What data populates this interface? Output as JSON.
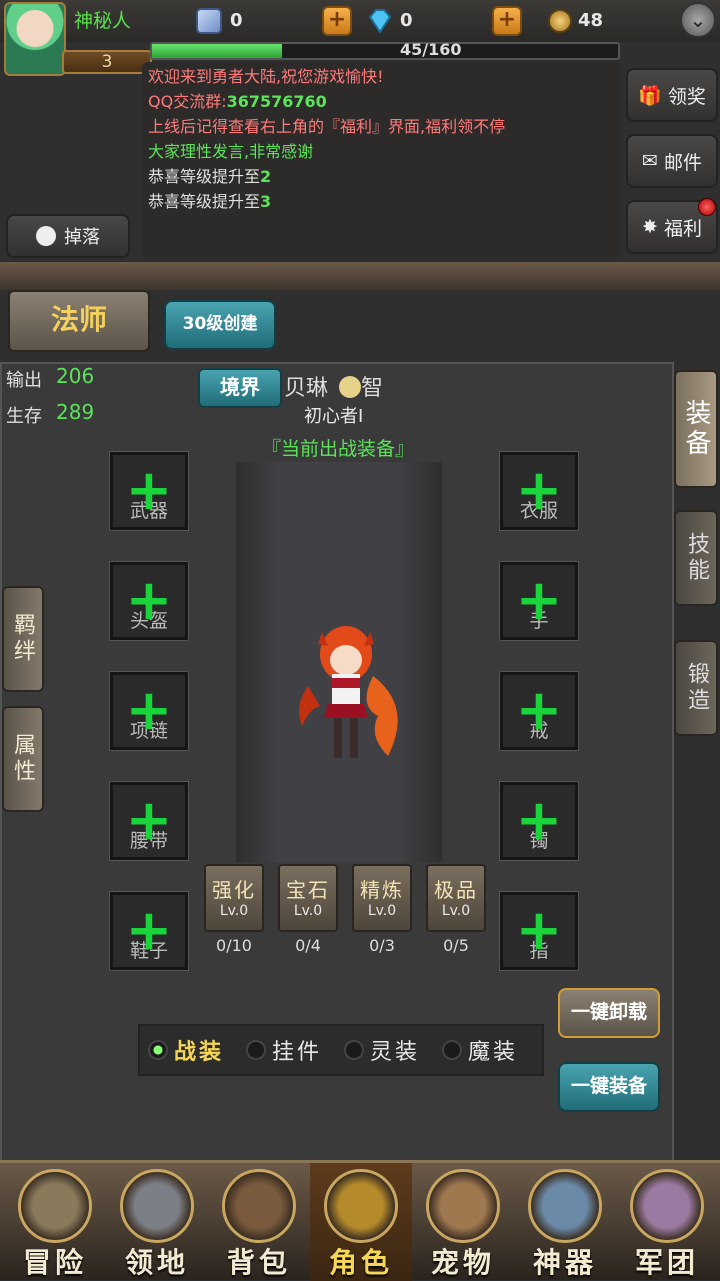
{
  "player": {
    "name": "神秘人",
    "level": "3",
    "exp_text": "45/160",
    "exp_progress": 0.28
  },
  "resources": [
    {
      "icon": "scroll-icon",
      "value": "0"
    },
    {
      "icon": "diamond-icon",
      "value": "0"
    },
    {
      "icon": "gold-coin-icon",
      "value": "48"
    }
  ],
  "chat": [
    {
      "text": "欢迎来到勇者大陆,祝您游戏愉快!",
      "color": "#ff7a7a"
    },
    {
      "prefix": "QQ交流群:",
      "text": "367576760",
      "color": "#ff7a7a",
      "highlight": "#5be35a"
    },
    {
      "text": "上线后记得查看右上角的『福利』界面,福利领不停",
      "color": "#ff7a7a"
    },
    {
      "text": "大家理性发言,非常感谢",
      "color": "#5be35a"
    },
    {
      "prefix": "恭喜等级提升至",
      "text": "2",
      "color": "#e0e0e0",
      "highlight": "#5be35a"
    },
    {
      "prefix": "恭喜等级提升至",
      "text": "3",
      "color": "#e0e0e0",
      "highlight": "#5be35a"
    }
  ],
  "side_buttons": {
    "claim": "领奖",
    "mail": "邮件",
    "welfare": "福利"
  },
  "drop_button": "掉落",
  "class_tab": "法师",
  "create_button": "30级创建",
  "stats": {
    "output_label": "输出",
    "output_value": "206",
    "survive_label": "生存",
    "survive_value": "289"
  },
  "realm_button": "境界",
  "hero": {
    "name": "贝琳",
    "attr": "智",
    "title": "初心者I",
    "current_equip": "『当前出战装备』"
  },
  "slots_left": [
    "武器",
    "头盔",
    "项链",
    "腰带",
    "鞋子"
  ],
  "slots_right": [
    "衣服",
    "手",
    "戒",
    "镯",
    "指"
  ],
  "upgrades": [
    {
      "title": "强化",
      "level": "Lv.0",
      "count": "0/10"
    },
    {
      "title": "宝石",
      "level": "Lv.0",
      "count": "0/4"
    },
    {
      "title": "精炼",
      "level": "Lv.0",
      "count": "0/3"
    },
    {
      "title": "极品",
      "level": "Lv.0",
      "count": "0/5"
    }
  ],
  "left_tabs": [
    "羁绊",
    "属性"
  ],
  "right_tabs": [
    "装备",
    "技能",
    "锻造"
  ],
  "actions": {
    "unequip_all": "一键卸载",
    "equip_all": "一键装备"
  },
  "suits": [
    {
      "label": "战装",
      "active": true
    },
    {
      "label": "挂件",
      "active": false
    },
    {
      "label": "灵装",
      "active": false
    },
    {
      "label": "魔装",
      "active": false
    }
  ],
  "nav": [
    {
      "label": "冒险",
      "icon": "crossed-swords-icon"
    },
    {
      "label": "领地",
      "icon": "shield-emblem-icon"
    },
    {
      "label": "背包",
      "icon": "bag-icon"
    },
    {
      "label": "角色",
      "icon": "helmet-icon",
      "active": true
    },
    {
      "label": "宠物",
      "icon": "beast-face-icon"
    },
    {
      "label": "神器",
      "icon": "artifact-icon"
    },
    {
      "label": "军团",
      "icon": "legion-icon"
    }
  ]
}
